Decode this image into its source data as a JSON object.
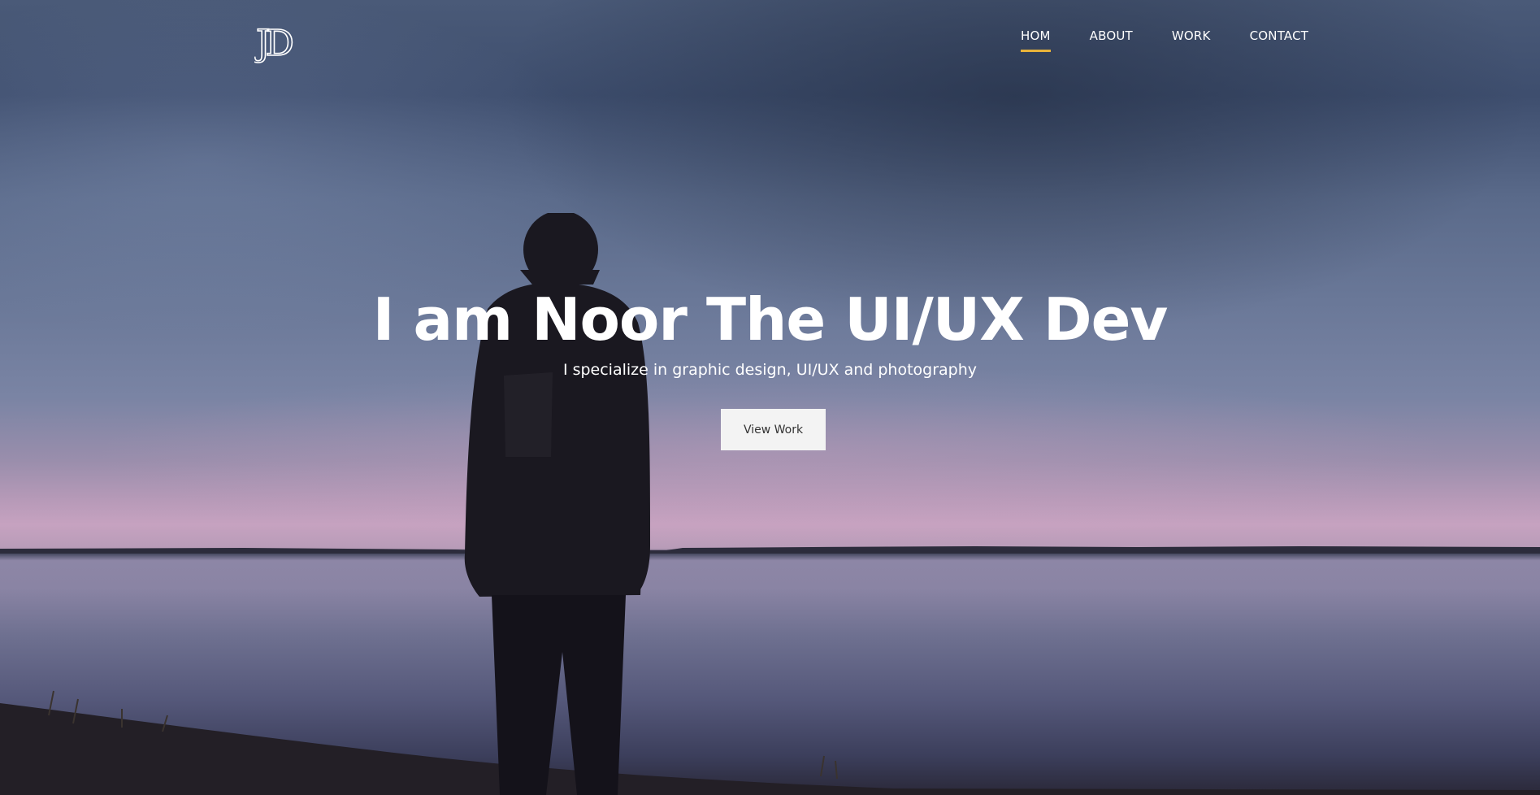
{
  "brand": {
    "logo_text": "JD"
  },
  "nav": {
    "items": [
      {
        "label": "HOM",
        "active": true
      },
      {
        "label": "ABOUT",
        "active": false
      },
      {
        "label": "WORK",
        "active": false
      },
      {
        "label": "CONTACT",
        "active": false
      }
    ]
  },
  "hero": {
    "headline": "I am Noor The UI/UX Dev",
    "subheadline": "I specialize in graphic design, UI/UX and photography",
    "cta_label": "View Work"
  },
  "colors": {
    "accent": "#e8b33a",
    "text": "#ffffff",
    "button_bg": "#f3f3f3",
    "button_text": "#333333"
  }
}
